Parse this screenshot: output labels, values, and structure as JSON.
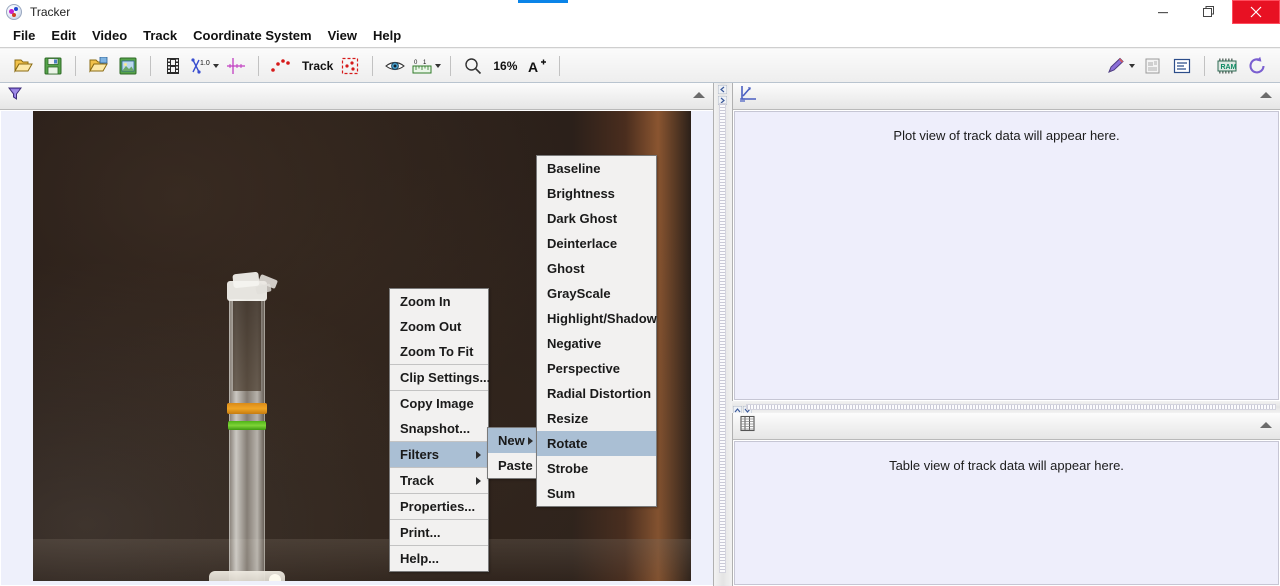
{
  "window": {
    "title": "Tracker",
    "app_icon": "tracker-logo-icon",
    "controls": {
      "minimize": "—",
      "restore": "❐",
      "close": "✕"
    }
  },
  "menubar": {
    "items": [
      {
        "label": "File"
      },
      {
        "label": "Edit"
      },
      {
        "label": "Video"
      },
      {
        "label": "Track"
      },
      {
        "label": "Coordinate System"
      },
      {
        "label": "View"
      },
      {
        "label": "Help"
      }
    ]
  },
  "toolbar": {
    "items": [
      {
        "name": "open-file-icon",
        "type": "icon"
      },
      {
        "name": "save-icon",
        "type": "icon"
      },
      {
        "name": "open-library-icon",
        "type": "icon"
      },
      {
        "name": "save-library-icon",
        "type": "icon"
      },
      {
        "name": "video-clip-icon",
        "type": "icon"
      },
      {
        "name": "calibration-icon",
        "type": "icon",
        "dropdown": true
      },
      {
        "name": "axes-icon",
        "type": "icon"
      },
      {
        "name": "track-icon",
        "type": "icon"
      },
      {
        "name": "track-button",
        "label": "Track",
        "type": "text"
      },
      {
        "name": "autotracker-icon",
        "type": "icon"
      },
      {
        "name": "eye-visibility-icon",
        "type": "icon"
      },
      {
        "name": "ruler-icon",
        "type": "icon",
        "dropdown": true
      },
      {
        "name": "zoom-magnifier-icon",
        "type": "icon"
      },
      {
        "name": "zoom-level",
        "label": "16%",
        "type": "text"
      },
      {
        "name": "font-size-icon",
        "type": "icon"
      },
      {
        "name": "drawing-pencil-icon",
        "type": "icon",
        "dropdown": true
      },
      {
        "name": "notes-icon",
        "type": "icon"
      },
      {
        "name": "data-tool-icon",
        "type": "icon"
      },
      {
        "name": "memory-ram-icon",
        "type": "icon"
      },
      {
        "name": "refresh-icon",
        "type": "icon"
      }
    ],
    "zoom_level": "16%"
  },
  "video_panel": {
    "header_icon": "filter-funnel-icon",
    "collapse_icon": "collapse-up-icon"
  },
  "plot_panel": {
    "header_icon": "plot-graph-icon",
    "message": "Plot view of track data will appear here.",
    "collapse_icon": "collapse-up-icon"
  },
  "table_panel": {
    "header_icon": "table-grid-icon",
    "message": "Table view of track data will appear here.",
    "collapse_icon": "collapse-up-icon"
  },
  "context_menu": {
    "items": [
      {
        "label": "Zoom In",
        "submenu": false,
        "selected": false,
        "sep_after": false
      },
      {
        "label": "Zoom Out",
        "submenu": false,
        "selected": false,
        "sep_after": false
      },
      {
        "label": "Zoom To Fit",
        "submenu": false,
        "selected": false,
        "sep_after": true
      },
      {
        "label": "Clip Settings...",
        "submenu": false,
        "selected": false,
        "sep_after": true
      },
      {
        "label": "Copy Image",
        "submenu": false,
        "selected": false,
        "sep_after": false
      },
      {
        "label": "Snapshot...",
        "submenu": false,
        "selected": false,
        "sep_after": true
      },
      {
        "label": "Filters",
        "submenu": true,
        "selected": true,
        "sep_after": true
      },
      {
        "label": "Track",
        "submenu": true,
        "selected": false,
        "sep_after": true
      },
      {
        "label": "Properties...",
        "submenu": false,
        "selected": false,
        "sep_after": true
      },
      {
        "label": "Print...",
        "submenu": false,
        "selected": false,
        "sep_after": true
      },
      {
        "label": "Help...",
        "submenu": false,
        "selected": false,
        "sep_after": false
      }
    ]
  },
  "filters_submenu": {
    "items": [
      {
        "label": "New",
        "submenu": true,
        "selected": true
      },
      {
        "label": "Paste",
        "submenu": false,
        "selected": false
      }
    ]
  },
  "new_filter_submenu": {
    "items": [
      {
        "label": "Baseline",
        "selected": false
      },
      {
        "label": "Brightness",
        "selected": false
      },
      {
        "label": "Dark Ghost",
        "selected": false
      },
      {
        "label": "Deinterlace",
        "selected": false
      },
      {
        "label": "Ghost",
        "selected": false
      },
      {
        "label": "GrayScale",
        "selected": false
      },
      {
        "label": "Highlight/Shadow",
        "selected": false
      },
      {
        "label": "Negative",
        "selected": false
      },
      {
        "label": "Perspective",
        "selected": false
      },
      {
        "label": "Radial Distortion",
        "selected": false
      },
      {
        "label": "Resize",
        "selected": false
      },
      {
        "label": "Rotate",
        "selected": true
      },
      {
        "label": "Strobe",
        "selected": false
      },
      {
        "label": "Sum",
        "selected": false
      }
    ]
  },
  "colors": {
    "menu_highlight": "#aabfd4",
    "panel_background": "#eeeefb",
    "close_button": "#e81123",
    "title_accent": "#0a84e8"
  }
}
